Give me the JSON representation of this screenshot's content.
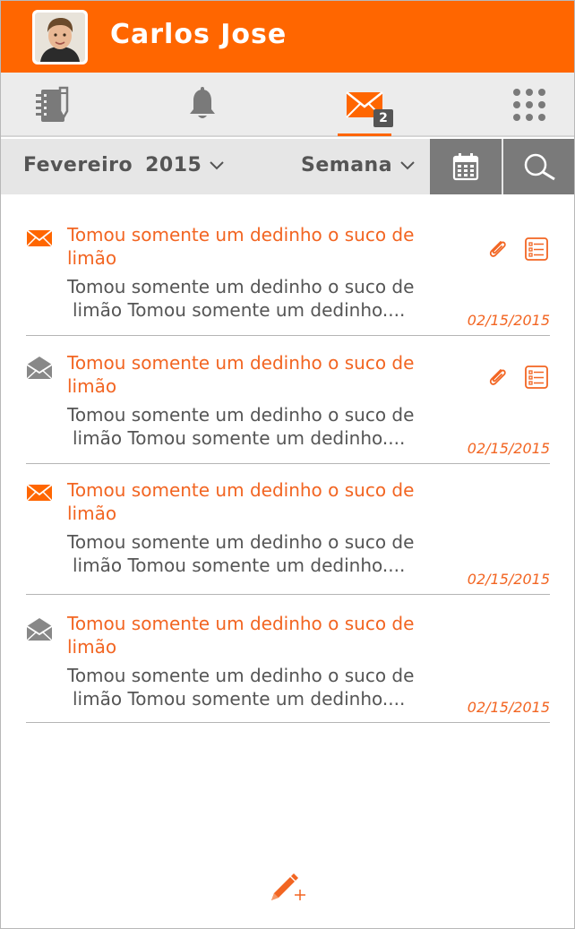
{
  "header": {
    "user_name": "Carlos Jose"
  },
  "tabs": [
    {
      "name": "notebook",
      "icon": "notebook-icon"
    },
    {
      "name": "notifications",
      "icon": "bell-icon"
    },
    {
      "name": "messages",
      "icon": "envelope-icon",
      "badge": "2",
      "active": true
    },
    {
      "name": "apps",
      "icon": "grid-icon"
    }
  ],
  "filters": {
    "month": "Fevereiro",
    "year": "2015",
    "period": "Semana"
  },
  "messages": [
    {
      "status": "unread",
      "title": "Tomou somente um dedinho o suco de limão",
      "body_line1": "Tomou somente um dedinho o suco de",
      "body_line2": "limão Tomou somente um dedinho....",
      "date": "02/15/2015",
      "has_attachment": true,
      "has_checklist": true
    },
    {
      "status": "read",
      "title": "Tomou somente um dedinho o suco de limão",
      "body_line1": "Tomou somente um dedinho o suco de",
      "body_line2": "limão Tomou somente um dedinho....",
      "date": "02/15/2015",
      "has_attachment": true,
      "has_checklist": true
    },
    {
      "status": "unread",
      "title": "Tomou somente um dedinho o suco de limão",
      "body_line1": "Tomou somente um dedinho o suco de",
      "body_line2": "limão Tomou somente um dedinho....",
      "date": "02/15/2015",
      "has_attachment": false,
      "has_checklist": false
    },
    {
      "status": "read",
      "title": "Tomou somente um dedinho o suco de limão",
      "body_line1": "Tomou somente um dedinho o suco de",
      "body_line2": "limão Tomou somente um dedinho....",
      "date": "02/15/2015",
      "has_attachment": false,
      "has_checklist": false
    }
  ],
  "colors": {
    "accent": "#ff6600",
    "text_orange": "#f26522",
    "text_gray": "#555555",
    "toolbar_gray": "#7a7a7a"
  }
}
